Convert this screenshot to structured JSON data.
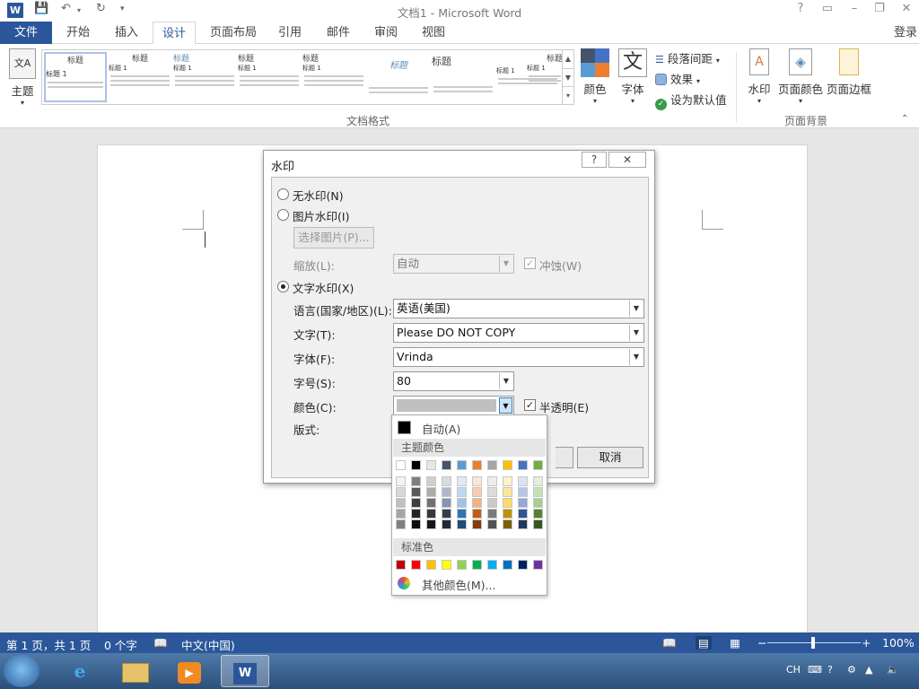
{
  "titlebar": {
    "title": "文档1 - Microsoft Word",
    "app_icon": "W",
    "help": "?",
    "buttons": [
      "restore-ribbon-icon",
      "minimize-icon",
      "maximize-icon",
      "close-icon"
    ]
  },
  "ribbon_tabs": {
    "file": "文件",
    "tabs": [
      "开始",
      "插入",
      "设计",
      "页面布局",
      "引用",
      "邮件",
      "审阅",
      "视图"
    ],
    "active": "设计",
    "login": "登录"
  },
  "ribbon": {
    "theme_label": "主题",
    "theme_icon": "文A",
    "gallery_items": [
      {
        "heading": "标题",
        "sub": "标题 1"
      },
      {
        "heading": "标题",
        "sub": "标题 1"
      },
      {
        "heading": "标题",
        "sub": "标题 1"
      },
      {
        "heading": "标题",
        "sub": "标题 1"
      },
      {
        "heading": "标题",
        "sub": "标题 1"
      },
      {
        "heading": "标题",
        "sub": ""
      },
      {
        "heading": "标题",
        "sub": ""
      },
      {
        "heading": "",
        "sub": "标题 1"
      },
      {
        "heading": "标题",
        "sub": "标题 1"
      }
    ],
    "group_doc_format": "文档格式",
    "colors": "颜色",
    "fonts": "字体",
    "fonts_icon": "文",
    "paragraph_spacing": "段落间距",
    "effects": "效果",
    "set_default": "设为默认值",
    "watermark": "水印",
    "page_color": "页面颜色",
    "page_borders": "页面边框",
    "group_page_background": "页面背景"
  },
  "dialog": {
    "title": "水印",
    "help": "?",
    "close": "✕",
    "no_watermark": "无水印(N)",
    "picture_watermark": "图片水印(I)",
    "select_picture": "选择图片(P)...",
    "scale_label": "缩放(L):",
    "scale_value": "自动",
    "washout": "冲蚀(W)",
    "text_watermark": "文字水印(X)",
    "language_label": "语言(国家/地区)(L):",
    "language_value": "英语(美国)",
    "text_label": "文字(T):",
    "text_value": "Please DO NOT COPY",
    "font_label": "字体(F):",
    "font_value": "Vrinda",
    "size_label": "字号(S):",
    "size_value": "80",
    "color_label": "颜色(C):",
    "semitransparent": "半透明(E)",
    "layout_label": "版式:",
    "cancel": "取消",
    "selected_option": "text_watermark"
  },
  "color_popup": {
    "auto": "自动(A)",
    "theme_colors_label": "主题颜色",
    "standard_colors_label": "标准色",
    "more_colors": "其他颜色(M)...",
    "theme_top": [
      "#ffffff",
      "#000000",
      "#e7e6e6",
      "#44546a",
      "#5b9bd5",
      "#ed7d31",
      "#a5a5a5",
      "#ffc000",
      "#4472c4",
      "#70ad47"
    ],
    "theme_shades": [
      [
        "#f2f2f2",
        "#7f7f7f",
        "#d0cece",
        "#d6dce4",
        "#deebf6",
        "#fbe5d5",
        "#ededed",
        "#fff2cc",
        "#dae3f3",
        "#e2efd9"
      ],
      [
        "#d8d8d8",
        "#595959",
        "#aeabab",
        "#adb9ca",
        "#bdd7ee",
        "#f7cbac",
        "#dbdbdb",
        "#fee599",
        "#b4c6e7",
        "#c5e0b3"
      ],
      [
        "#bfbfbf",
        "#3f3f3f",
        "#757070",
        "#8496b0",
        "#9dc3e6",
        "#f4b183",
        "#c9c9c9",
        "#ffd965",
        "#8eaadb",
        "#a8d08d"
      ],
      [
        "#a5a5a5",
        "#262626",
        "#3a3838",
        "#323f4f",
        "#2e75b5",
        "#c55a11",
        "#7b7b7b",
        "#bf9000",
        "#2f5496",
        "#538135"
      ],
      [
        "#7f7f7f",
        "#0c0c0c",
        "#171616",
        "#222a35",
        "#1f4e79",
        "#833c0b",
        "#525252",
        "#7f6000",
        "#1f3864",
        "#375623"
      ]
    ],
    "standard": [
      "#c00000",
      "#ff0000",
      "#ffc000",
      "#ffff00",
      "#92d050",
      "#00b050",
      "#00b0f0",
      "#0070c0",
      "#002060",
      "#7030a0"
    ],
    "selected_color": "#c0c0c0"
  },
  "statusbar": {
    "page": "第 1 页，共 1 页",
    "words": "0 个字",
    "language": "中文(中国)",
    "zoom": "100%",
    "zoom_fraction": 0.5
  },
  "taskbar": {
    "apps": [
      "ie-icon",
      "explorer-icon",
      "media-player-icon",
      "word-icon"
    ],
    "active_app": "word-icon",
    "input_lang": "CH"
  },
  "accent_color": "#2b579a"
}
